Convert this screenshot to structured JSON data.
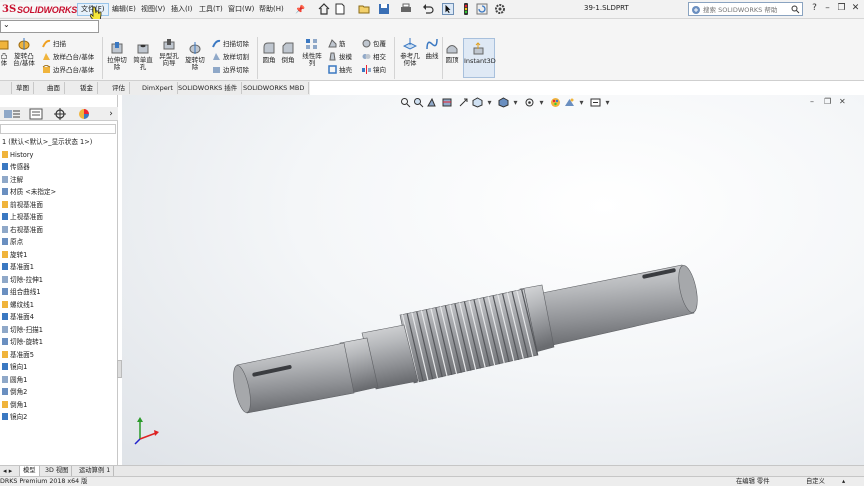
{
  "titlebar": {
    "menus": [
      "文件(F)",
      "编辑(E)",
      "视图(V)",
      "插入(I)",
      "工具(T)",
      "窗口(W)",
      "帮助(H)"
    ],
    "document_title": "39-1.SLDPRT",
    "search_placeholder": "搜索 SOLIDWORKS 帮助",
    "pin_glyph": "📌"
  },
  "ribbon": {
    "left_group": {
      "big_buttons": [
        {
          "label_line1": "凸",
          "label_line2": "体"
        },
        {
          "label_line1": "旋转凸",
          "label_line2": "台/基体"
        }
      ],
      "small_rows": [
        "扫描",
        "放样凸台/基体",
        "边界凸台/基体"
      ]
    },
    "features": [
      {
        "line1": "拉伸切",
        "line2": "除"
      },
      {
        "line1": "简单直",
        "line2": "孔"
      },
      {
        "line1": "异型孔",
        "line2": "向导"
      },
      {
        "line1": "旋转切",
        "line2": "除"
      }
    ],
    "cut_rows": [
      "扫描切除",
      "放样切割",
      "边界切除"
    ],
    "fillet": [
      "圆角",
      "倒角"
    ],
    "pattern": {
      "line1": "线性阵",
      "line2": "列"
    },
    "pattern_rows": [
      "筋",
      "拔模",
      "抽壳"
    ],
    "wrap_rows": [
      "包覆",
      "相交",
      "镜向"
    ],
    "refgeom": {
      "line1": "参考几",
      "line2": "何体"
    },
    "curves": "曲线",
    "dome": "圆顶",
    "instant3d": "Instant3D"
  },
  "command_tabs": [
    "草图",
    "曲面",
    "钣金",
    "评估",
    "DimXpert",
    "SOLIDWORKS 插件",
    "SOLIDWORKS MBD"
  ],
  "feature_tree": {
    "root": "1  (默认<默认>_显示状态 1>)",
    "items": [
      "History",
      "传感器",
      "注解",
      "材质 <未指定>",
      "前视基准面",
      "上视基准面",
      "右视基准面",
      "原点",
      "旋转1",
      "基准面1",
      "切除-拉伸1",
      "组合曲线1",
      "螺纹线1",
      "基准面4",
      "切除-扫描1",
      "切除-旋转1",
      "基准面5",
      "镜向1",
      "圆角1",
      "倒角2",
      "倒角1",
      "镜向2"
    ]
  },
  "bottom_tabs": [
    "模型",
    "3D 视图",
    "运动算例 1"
  ],
  "status": {
    "version": "DRKS Premium 2018 x64 版",
    "mode": "在编辑 零件",
    "custom": "自定义"
  },
  "colors": {
    "brand_red": "#c8102e",
    "part_gray": "#9a9c9f",
    "accent_blue": "#3a78c2"
  }
}
